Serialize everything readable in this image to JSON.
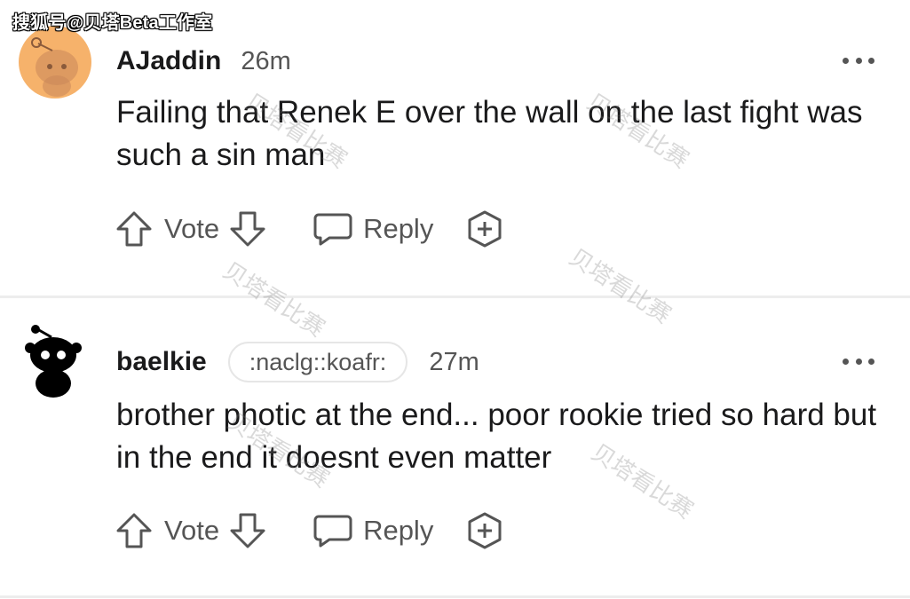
{
  "source_watermark": "搜狐号@贝塔Beta工作室",
  "overlay_watermark": "贝塔看比赛",
  "comments": [
    {
      "username": "AJaddin",
      "timestamp": "26m",
      "flair": "",
      "body": "Failing that Renek E over the wall on the last fight was such a sin man",
      "vote_label": "Vote",
      "reply_label": "Reply"
    },
    {
      "username": "baelkie",
      "timestamp": "27m",
      "flair": ":naclg::koafr:",
      "body": "brother photic at the end... poor rookie tried so hard but in the end it doesnt even matter",
      "vote_label": "Vote",
      "reply_label": "Reply"
    }
  ],
  "colors": {
    "text": "#1a1a1b",
    "muted": "#555555",
    "avatar_1_bg": "#f6b26b",
    "divider": "#ededed"
  },
  "icons": [
    "upvote-icon",
    "downvote-icon",
    "reply-bubble-icon",
    "award-plus-icon",
    "more-dots-icon"
  ]
}
